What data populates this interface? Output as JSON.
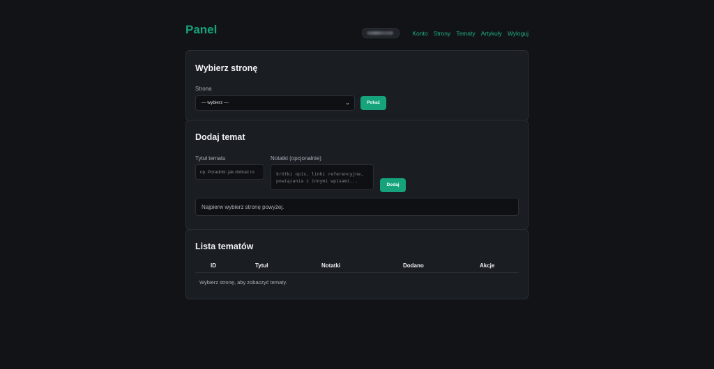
{
  "header": {
    "logo": "Panel",
    "nav": [
      "Konto",
      "Strony",
      "Tematy",
      "Artykuły",
      "Wyloguj"
    ]
  },
  "select_page": {
    "title": "Wybierz stronę",
    "label": "Strona",
    "selected": "— wybierz —",
    "button": "Pokaż"
  },
  "add_topic": {
    "title": "Dodaj temat",
    "title_label": "Tytuł tematu",
    "title_placeholder": "np. Poradnik: jak dobrać ro",
    "notes_label": "Notatki (opcjonalnie)",
    "notes_placeholder": "krótki opis, linki referencyjne,\npowiązania z innymi wpisami...",
    "button": "Dodaj",
    "info": "Najpierw wybierz stronę powyżej."
  },
  "topic_list": {
    "title": "Lista tematów",
    "columns": [
      "ID",
      "Tytuł",
      "Notatki",
      "Dodano",
      "Akcje"
    ],
    "empty": "Wybierz stronę, aby zobaczyć tematy."
  },
  "colors": {
    "accent": "#16a37c",
    "background": "#111317",
    "card": "#1a1d22"
  }
}
